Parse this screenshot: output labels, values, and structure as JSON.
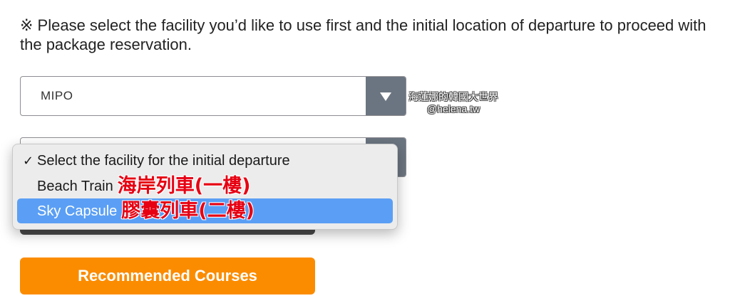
{
  "notice": {
    "text": "※ Please select the facility you’d like to use first and the initial location of departure to proceed with the package reservation."
  },
  "location_select": {
    "value": "MIPO"
  },
  "watermark": {
    "line1": "海蓮娜的韓國大世界",
    "line2": "@helena.tw"
  },
  "facility_dropdown": {
    "options": [
      {
        "label": "Select the facility for the initial departure",
        "checked": true,
        "annotation": ""
      },
      {
        "label": "Beach Train",
        "checked": false,
        "annotation": "海岸列車(一樓)"
      },
      {
        "label": "Sky Capsule",
        "checked": false,
        "annotation": "膠囊列車(二樓)",
        "highlighted": true
      }
    ],
    "check_mark": "✓"
  },
  "cta": {
    "label": "Recommended Courses"
  },
  "colors": {
    "select_arrow_bg": "#6b7581",
    "highlight": "#5a9ff5",
    "cta_bg": "#fb8c00",
    "annotation_red": "#e60012"
  }
}
